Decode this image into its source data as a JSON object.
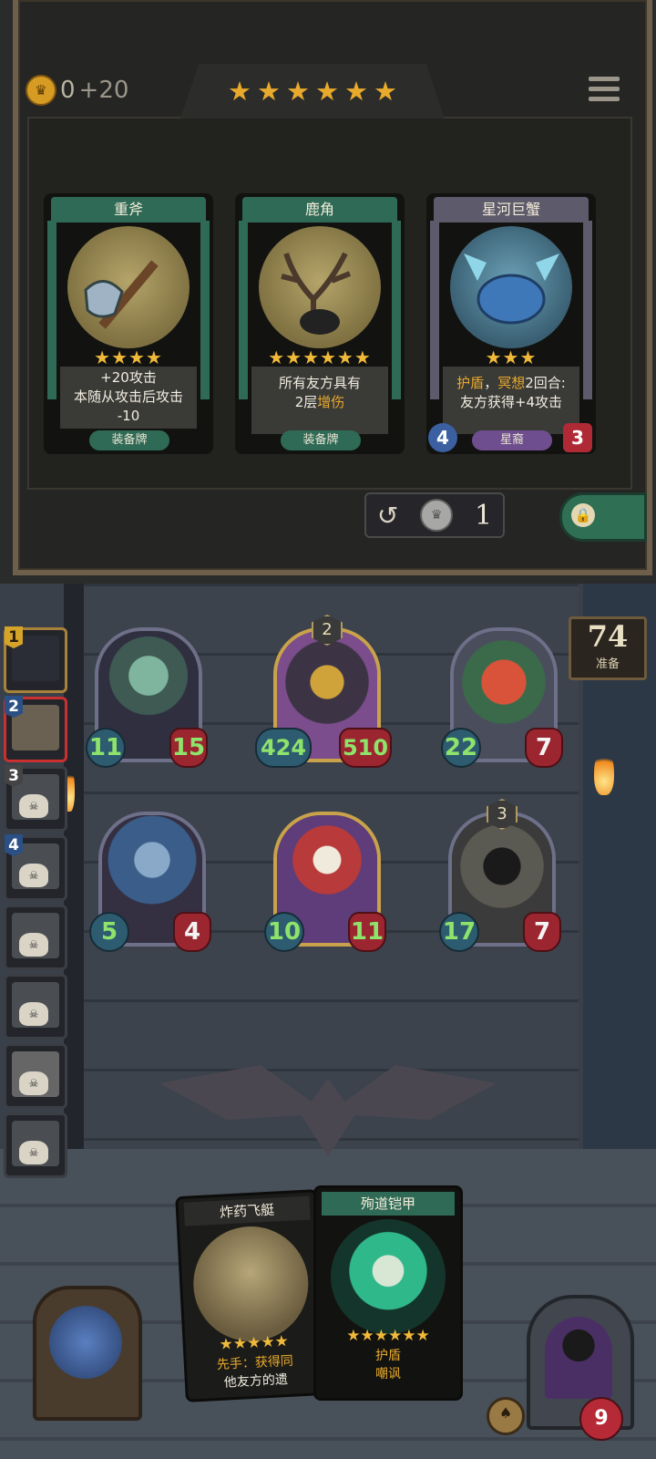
{
  "shop": {
    "gold": {
      "current": "0",
      "income": "+20"
    },
    "tier_stars": 6,
    "cards": [
      {
        "name": "重斧",
        "stars": "★★★★",
        "desc_line1": "+20攻击",
        "desc_line2": "本随从攻击后攻击",
        "desc_line3": "-10",
        "type": "装备牌"
      },
      {
        "name": "鹿角",
        "stars": "★★★★★★",
        "desc_line1": "所有友方具有",
        "desc_line2a": "2层",
        "desc_line2b": "增伤",
        "type": "装备牌"
      },
      {
        "name": "星河巨蟹",
        "stars": "★★★",
        "kw1": "护盾",
        "sep": "，",
        "kw2": "冥想",
        "desc_line1_rest": "2回合:",
        "desc_line2": "友方获得+4攻击",
        "type": "星裔",
        "attack": "4",
        "health": "3"
      }
    ],
    "refresh_cost": "1"
  },
  "prep": {
    "count": "74",
    "label": "准备"
  },
  "roster": [
    {
      "rank": "1"
    },
    {
      "rank": "2"
    },
    {
      "rank": "3"
    },
    {
      "rank": "4"
    },
    {
      "rank": ""
    },
    {
      "rank": ""
    },
    {
      "rank": ""
    },
    {
      "rank": ""
    }
  ],
  "board": {
    "minions": [
      {
        "name": "demon-elf",
        "attack": "11",
        "health": "15",
        "tier": ""
      },
      {
        "name": "golden-knight",
        "attack": "424",
        "health": "510",
        "tier": "2"
      },
      {
        "name": "red-devil",
        "attack": "22",
        "health": "7",
        "tier": ""
      },
      {
        "name": "siren-elf",
        "attack": "5",
        "health": "4",
        "tier": ""
      },
      {
        "name": "jester",
        "attack": "10",
        "health": "11",
        "tier": ""
      },
      {
        "name": "dark-knight",
        "attack": "17",
        "health": "7",
        "tier": "3"
      }
    ]
  },
  "hand": [
    {
      "name": "炸药飞艇",
      "stars": "★★★★★",
      "desc_line1": "先手：获得同",
      "desc_line2": "他友方的遗"
    },
    {
      "name": "殉道铠甲",
      "stars": "★★★★★★",
      "desc_line1": "护盾",
      "desc_line2": "嘲讽"
    }
  ],
  "hero": {
    "health": "9"
  },
  "colors": {
    "gold": "#e8a92c",
    "equip_green": "#2f6a57",
    "attack_green": "#8ee36b",
    "health_red": "#9b2630"
  }
}
